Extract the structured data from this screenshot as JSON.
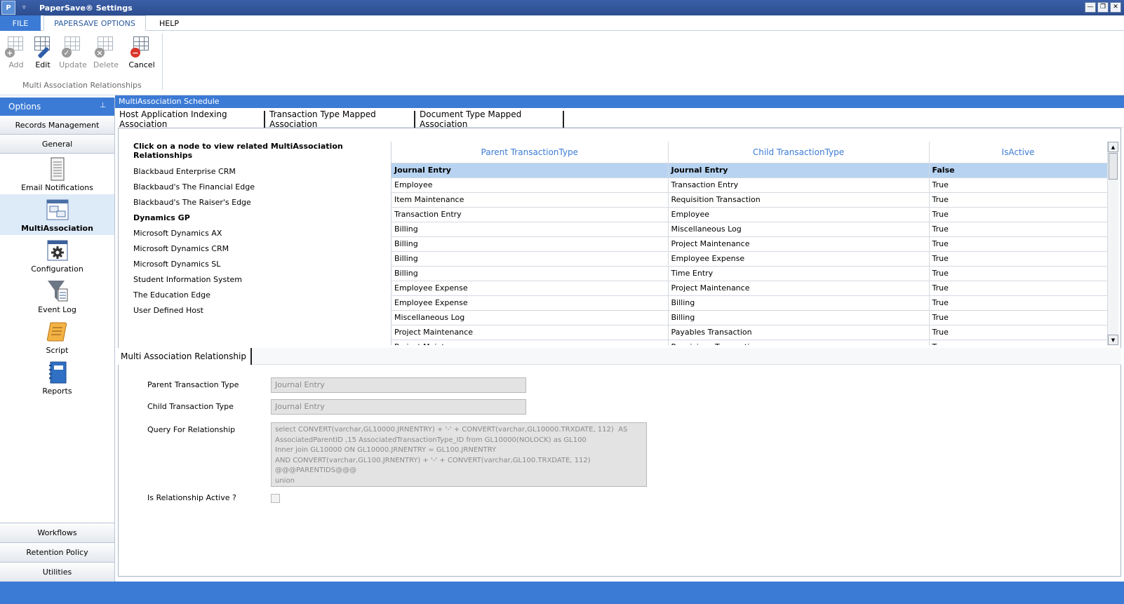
{
  "window": {
    "title": "PaperSave® Settings",
    "logo_text": "P",
    "qat_glyph": "▿",
    "minimize": "—",
    "maximize": "❐",
    "close": "✕"
  },
  "menu": {
    "file": "FILE",
    "options": "PAPERSAVE OPTIONS",
    "help": "HELP"
  },
  "ribbon": {
    "group_label": "Multi Association Relationships",
    "buttons": [
      {
        "label": "Add",
        "icon": "add-icon",
        "enabled": false
      },
      {
        "label": "Edit",
        "icon": "edit-icon",
        "enabled": true
      },
      {
        "label": "Update",
        "icon": "update-icon",
        "enabled": false
      },
      {
        "label": "Delete",
        "icon": "delete-icon",
        "enabled": false
      },
      {
        "label": "Cancel",
        "icon": "cancel-icon",
        "enabled": true
      }
    ]
  },
  "sidebar": {
    "header": "Options",
    "pin_glyph": "📌",
    "tabs_top": [
      "Records Management",
      "General"
    ],
    "items": [
      {
        "label": "Email Notifications",
        "icon": "email-notifications-icon"
      },
      {
        "label": "MultiAssociation",
        "icon": "multiassociation-icon",
        "active": true
      },
      {
        "label": "Configuration",
        "icon": "configuration-icon"
      },
      {
        "label": "Event Log",
        "icon": "event-log-icon"
      },
      {
        "label": "Script",
        "icon": "script-icon"
      },
      {
        "label": "Reports",
        "icon": "reports-icon"
      }
    ],
    "tabs_bottom": [
      "Workflows",
      "Retention Policy",
      "Utilities"
    ]
  },
  "main": {
    "header": "MultiAssociation Schedule",
    "tabs": [
      "Host Application Indexing Association",
      "Transaction Type Mapped Association",
      "Document Type Mapped Association"
    ],
    "tree": {
      "title": "Click on a node to view related MultiAssociation Relationships",
      "nodes": [
        "Blackbaud Enterprise CRM",
        "Blackbaud's The Financial Edge",
        "Blackbaud's The Raiser's Edge",
        "Dynamics GP",
        "Microsoft Dynamics AX",
        "Microsoft Dynamics CRM",
        "Microsoft Dynamics SL",
        "Student Information System",
        "The Education Edge",
        "User Defined Host"
      ],
      "selected": "Dynamics GP"
    },
    "grid": {
      "columns": [
        "Parent TransactionType",
        "Child TransactionType",
        "IsActive"
      ],
      "rows": [
        [
          "Journal Entry",
          "Journal Entry",
          "False"
        ],
        [
          "Employee",
          "Transaction Entry",
          "True"
        ],
        [
          "Item Maintenance",
          "Requisition Transaction",
          "True"
        ],
        [
          "Transaction Entry",
          "Employee",
          "True"
        ],
        [
          "Billing",
          "Miscellaneous Log",
          "True"
        ],
        [
          "Billing",
          "Project Maintenance",
          "True"
        ],
        [
          "Billing",
          "Employee Expense",
          "True"
        ],
        [
          "Billing",
          "Time Entry",
          "True"
        ],
        [
          "Employee Expense",
          "Project Maintenance",
          "True"
        ],
        [
          "Employee Expense",
          "Billing",
          "True"
        ],
        [
          "Miscellaneous Log",
          "Billing",
          "True"
        ],
        [
          "Project Maintenance",
          "Payables Transaction",
          "True"
        ],
        [
          "Project Maintenance",
          "Receivings Transaction",
          "True"
        ]
      ],
      "scroll_up": "▲",
      "scroll_down": "▼"
    },
    "relationship": {
      "tab": "Multi Association Relationship",
      "parent_label": "Parent Transaction Type",
      "parent_value": "Journal Entry",
      "child_label": "Child Transaction Type",
      "child_value": "Journal Entry",
      "query_label": "Query For Relationship",
      "query_value": "select CONVERT(varchar,GL10000.JRNENTRY) + '-' + CONVERT(varchar,GL10000.TRXDATE, 112)  AS\nAssociatedParentID ,15 AssociatedTransactionType_ID from GL10000(NOLOCK) as GL100\nInner join GL10000 ON GL10000.JRNENTRY = GL100.JRNENTRY\nAND CONVERT(varchar,GL100.JRNENTRY) + '-' + CONVERT(varchar,GL100.TRXDATE, 112)\n@@@PARENTIDS@@@\nunion",
      "active_label": "Is Relationship Active ?",
      "active_value": false
    }
  },
  "colors": {
    "accent": "#3c7bd5",
    "selected_row": "#b7d3f1"
  }
}
